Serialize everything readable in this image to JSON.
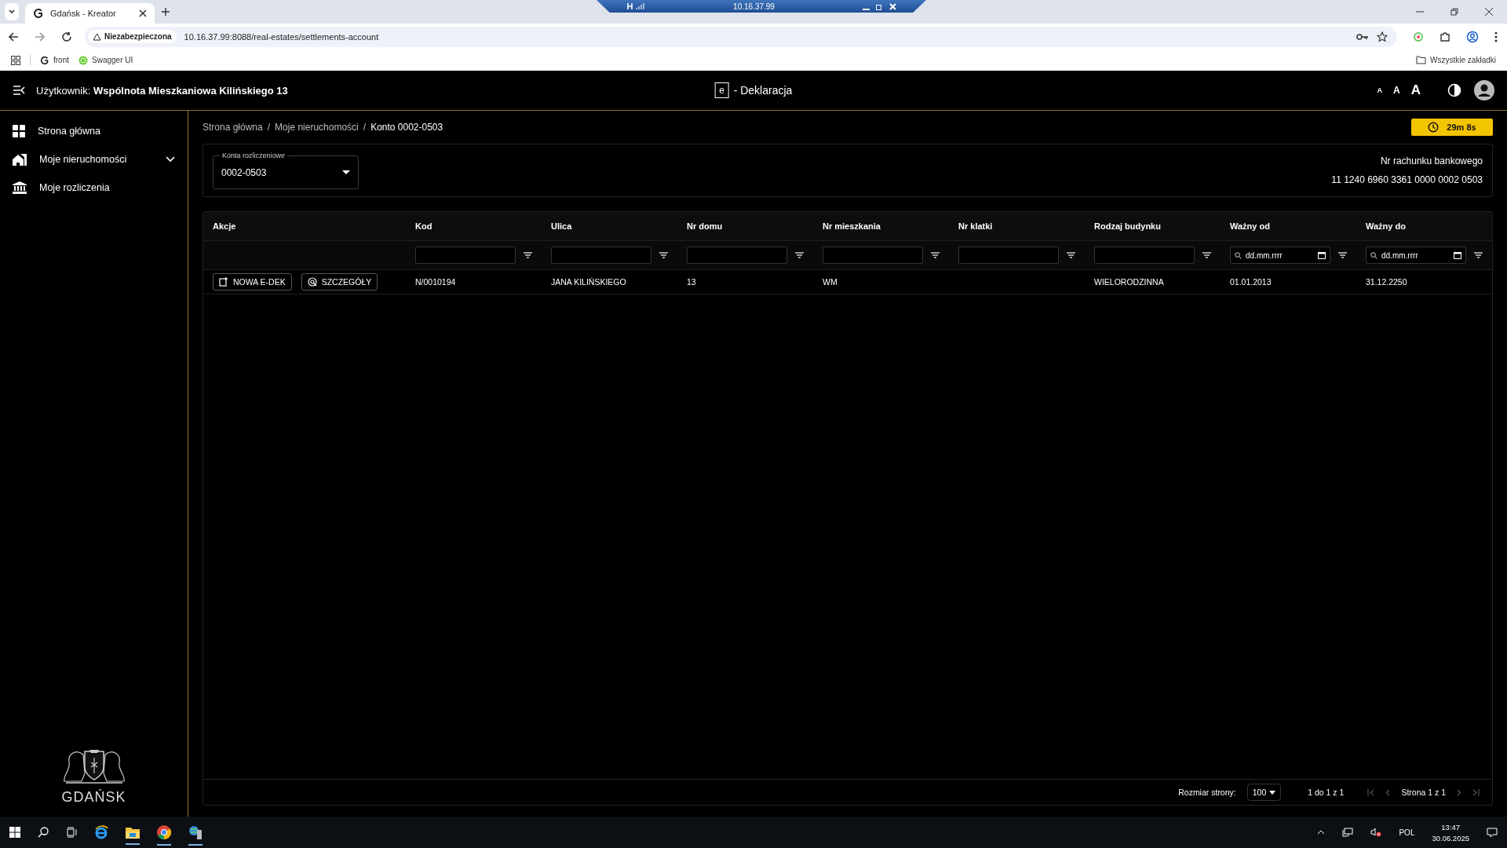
{
  "browser": {
    "tab_title": "Gdańsk - Kreator",
    "warning": "Niezabezpieczona",
    "url": "10.16.37.99:8088/real-estates/settlements-account",
    "bookmarks": [
      "front",
      "Swagger UI"
    ],
    "all_bookmarks": "Wszystkie zakładki"
  },
  "remote_bar": {
    "title": "10.16.37.99"
  },
  "header": {
    "user_label": "Użytkownik:",
    "user_name": "Wspólnota Mieszkaniowa Kilińskiego 13",
    "logo_letter": "e",
    "app_title": "- Deklaracja",
    "font_sizes": [
      "A",
      "A",
      "A"
    ]
  },
  "sidebar": {
    "items": [
      {
        "label": "Strona główna",
        "kind": "grid",
        "expandable": false
      },
      {
        "label": "Moje nieruchomości",
        "kind": "house",
        "expandable": true
      },
      {
        "label": "Moje rozliczenia",
        "kind": "bank",
        "expandable": false
      }
    ],
    "logo_text": "GDAŃSK"
  },
  "breadcrumbs": {
    "items": [
      "Strona główna",
      "Moje nieruchomości",
      "Konto 0002-0503"
    ],
    "separator": "/"
  },
  "timer": "29m 8s",
  "account_select": {
    "label": "Konta rozliczeniowe",
    "value": "0002-0503"
  },
  "bank_account": {
    "label": "Nr rachunku bankowego",
    "number": "11 1240 6960 3361 0000 0002 0503"
  },
  "table": {
    "columns": [
      {
        "label": "Akcje",
        "kind": "plain"
      },
      {
        "label": "Kod",
        "kind": "text"
      },
      {
        "label": "Ulica",
        "kind": "text"
      },
      {
        "label": "Nr domu",
        "kind": "text"
      },
      {
        "label": "Nr mieszkania",
        "kind": "text"
      },
      {
        "label": "Nr klatki",
        "kind": "text"
      },
      {
        "label": "Rodzaj budynku",
        "kind": "text"
      },
      {
        "label": "Ważny od",
        "kind": "date",
        "placeholder": "dd.mm.rrrr"
      },
      {
        "label": "Ważny do",
        "kind": "date",
        "placeholder": "dd.mm.rrrr"
      }
    ],
    "rows": [
      {
        "actions": [
          {
            "label": "NOWA E-DEK",
            "kind": "new"
          },
          {
            "label": "SZCZEGÓŁY",
            "kind": "details"
          }
        ],
        "cells": [
          "",
          "N/0010194",
          "JANA KILIŃSKIEGO",
          "13",
          "WM",
          "",
          "WIELORODZINNA",
          "01.01.2013",
          "31.12.2250"
        ]
      }
    ]
  },
  "pagination": {
    "page_size_label": "Rozmiar strony:",
    "page_size": "100",
    "range": "1 do 1 z 1",
    "page": "Strona 1 z 1"
  },
  "taskbar": {
    "language": "POL",
    "time": "13:47",
    "date": "30.06.2025"
  }
}
